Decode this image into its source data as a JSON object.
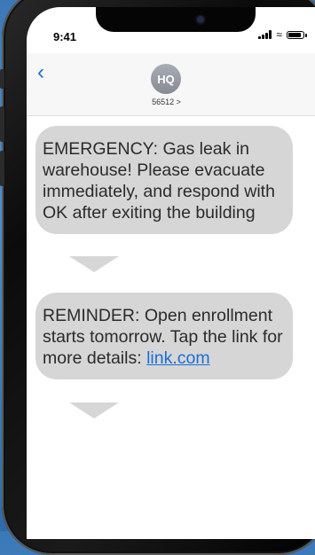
{
  "status_bar": {
    "time": "9:41"
  },
  "header": {
    "avatar_initials": "HQ",
    "contact_number": "56512 >"
  },
  "messages": [
    {
      "text": "EMERGENCY: Gas leak in warehouse! Please evacuate immediately, and respond with OK after exiting the building"
    },
    {
      "text_before_link": "REMINDER: Open enrollment starts tomorrow. Tap the link for more details: ",
      "link_text": "link.com"
    }
  ],
  "colors": {
    "bubble": "#d6d6d6",
    "link": "#1b6fd8",
    "accent": "#1b6fd8"
  },
  "icons": {
    "back": "chevron-left-icon",
    "signal": "signal-icon",
    "wifi": "wifi-icon",
    "battery": "battery-icon"
  }
}
